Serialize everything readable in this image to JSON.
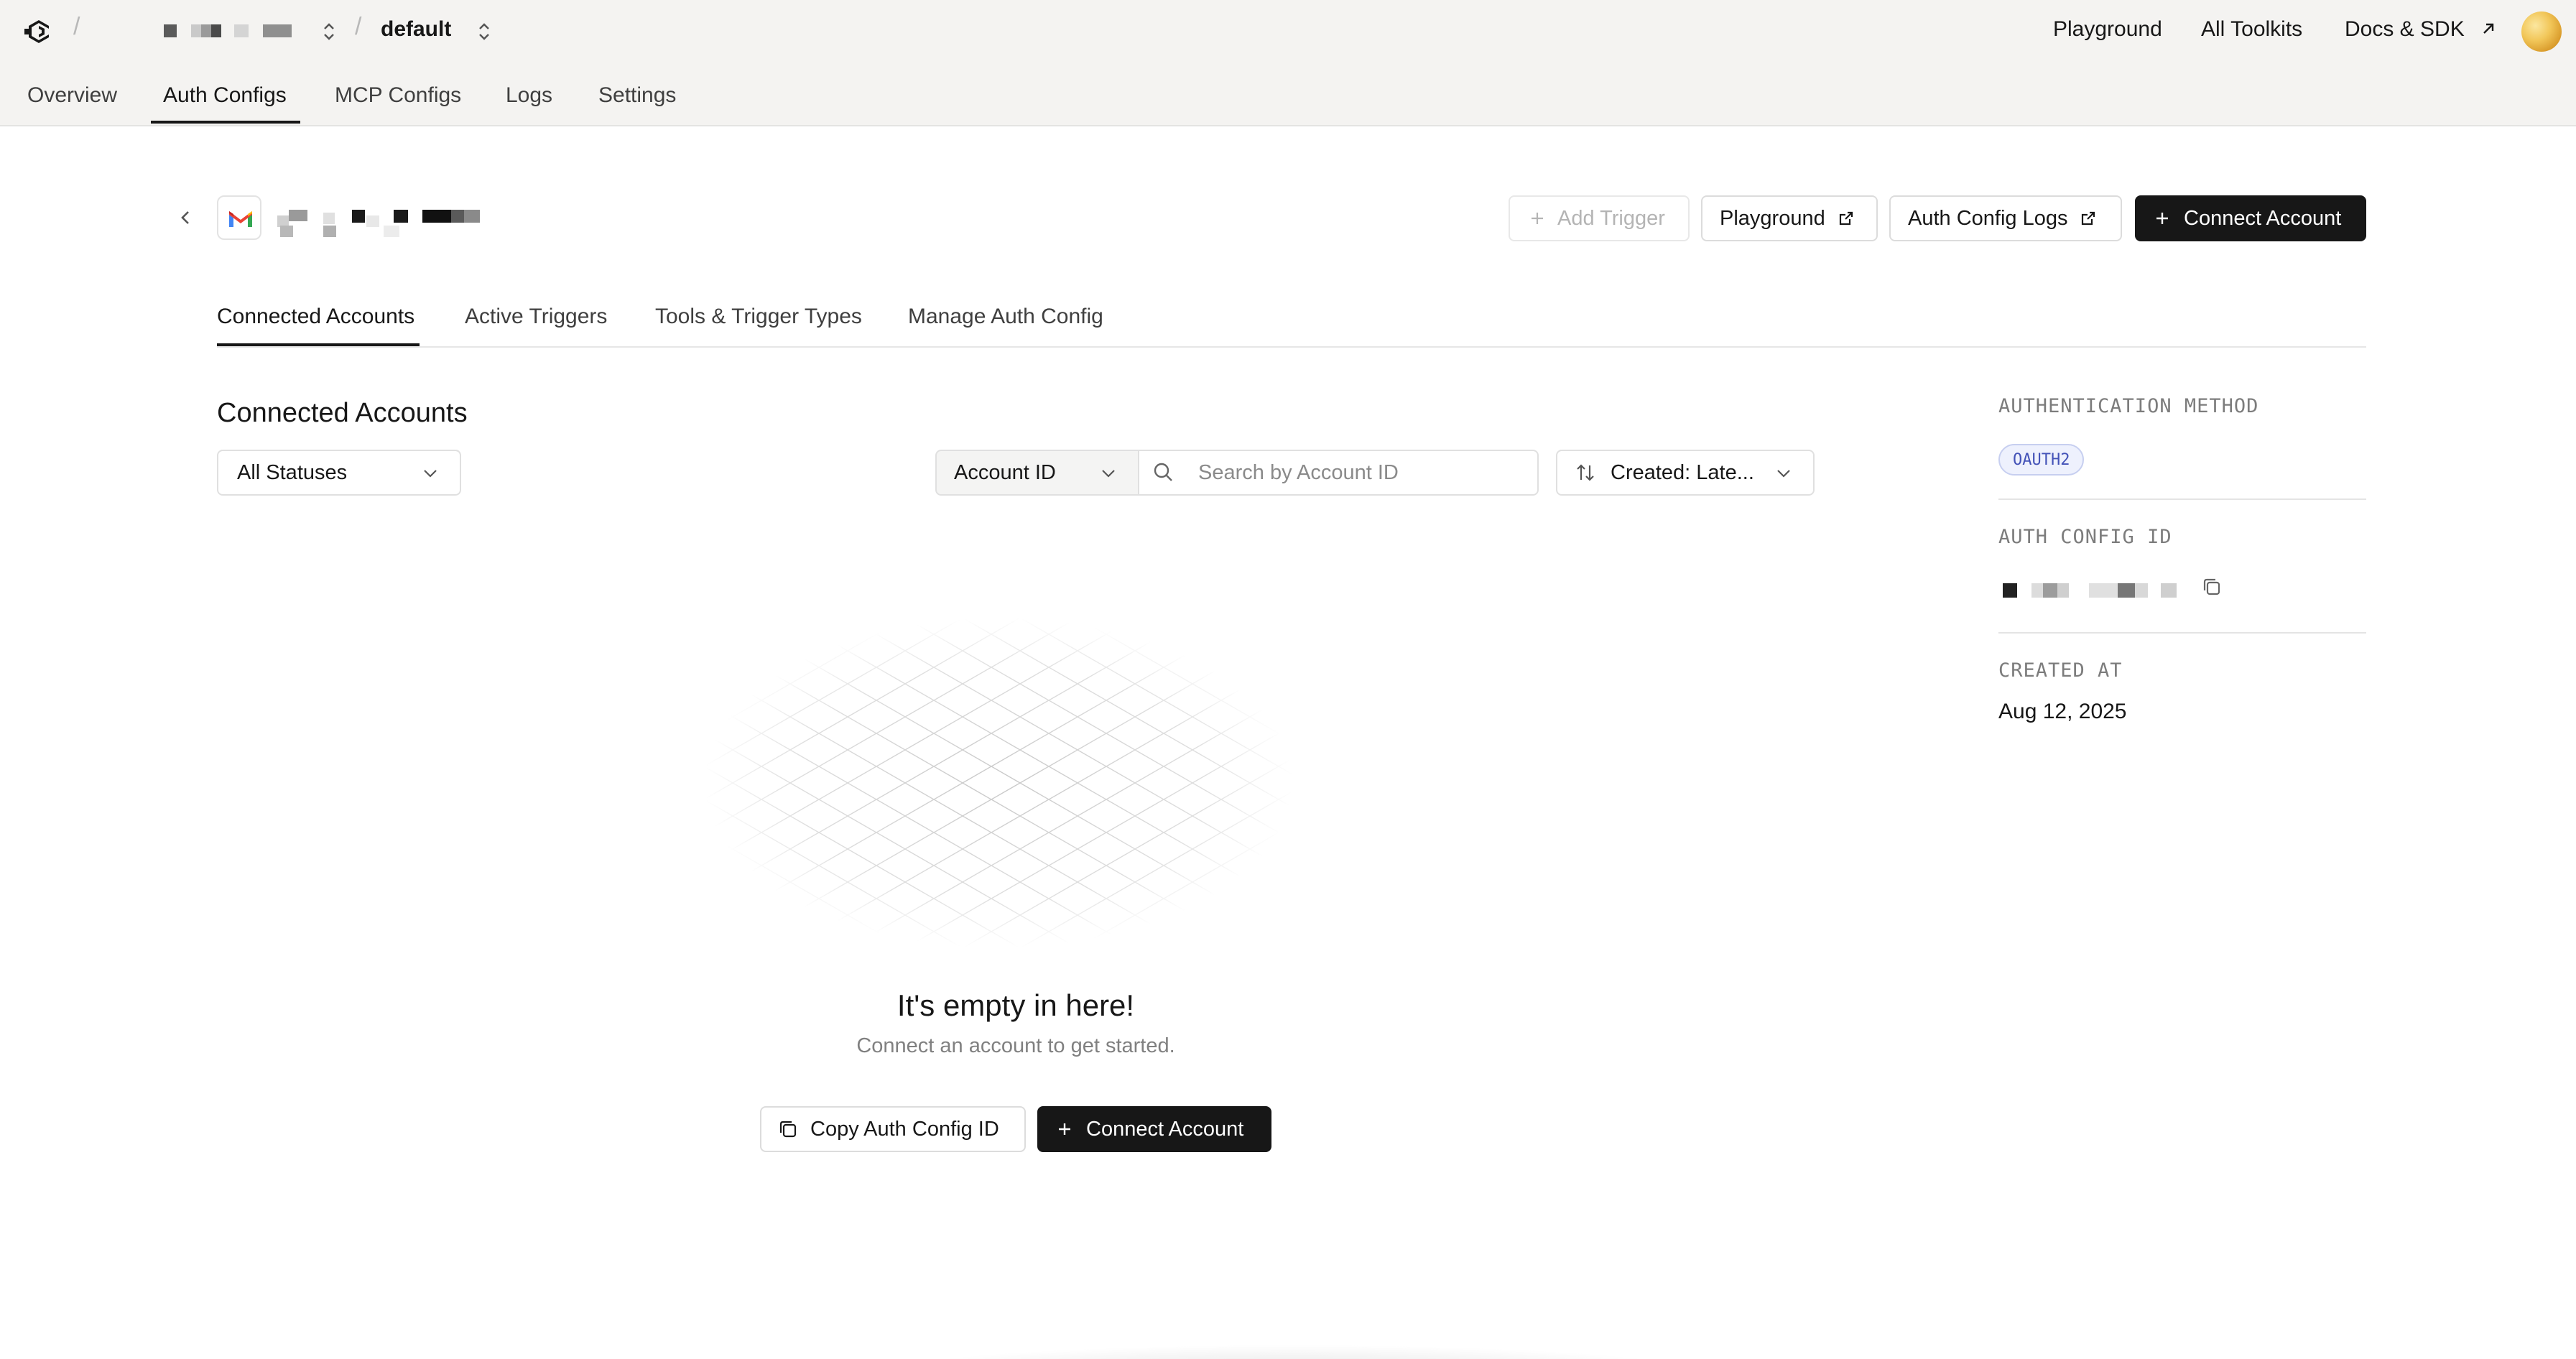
{
  "topbar": {
    "project_name": "default",
    "links": {
      "playground": "Playground",
      "all_toolkits": "All Toolkits",
      "docs_sdk": "Docs & SDK"
    }
  },
  "nav": {
    "tabs": [
      "Overview",
      "Auth Configs",
      "MCP Configs",
      "Logs",
      "Settings"
    ],
    "active": "Auth Configs"
  },
  "header": {
    "add_trigger": "Add Trigger",
    "playground": "Playground",
    "auth_config_logs": "Auth Config Logs",
    "connect_account": "Connect Account"
  },
  "subtabs": {
    "items": [
      "Connected Accounts",
      "Active Triggers",
      "Tools & Trigger Types",
      "Manage Auth Config"
    ],
    "active": "Connected Accounts"
  },
  "section": {
    "title": "Connected Accounts",
    "status_filter": "All Statuses",
    "search_field": "Account ID",
    "search_placeholder": "Search by Account ID",
    "sort": "Created: Late..."
  },
  "info": {
    "auth_method_label": "AUTHENTICATION METHOD",
    "auth_method_value": "OAUTH2",
    "auth_config_id_label": "AUTH CONFIG ID",
    "created_at_label": "CREATED AT",
    "created_at_value": "Aug 12, 2025"
  },
  "empty_state": {
    "title": "It's empty in here!",
    "subtitle": "Connect an account to get started.",
    "copy_button": "Copy Auth Config ID",
    "connect_button": "Connect Account"
  },
  "colors": {
    "topbar_bg": "#f4f3f1",
    "primary_dark": "#171717",
    "badge_bg": "#eef1fd",
    "badge_text": "#4453b8"
  }
}
